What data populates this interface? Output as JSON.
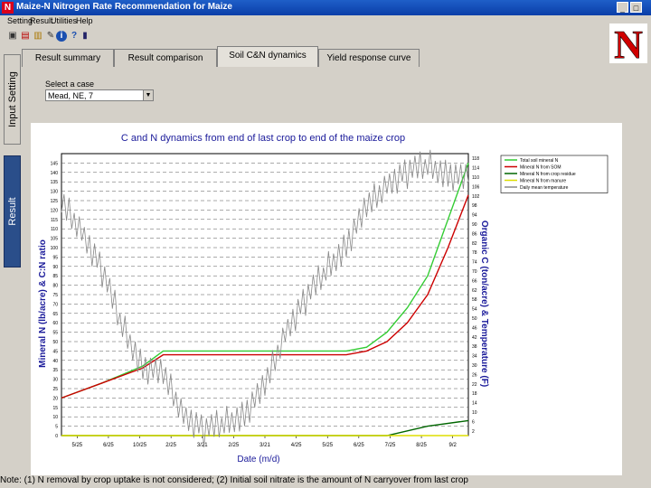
{
  "window": {
    "title": "Maize-N Nitrogen Rate Recommendation for Maize",
    "app_icon_letter": "N",
    "buttons": [
      "_",
      "□"
    ]
  },
  "menu": [
    "Setting",
    "Result",
    "Utilities",
    "Help"
  ],
  "toolbar": [
    {
      "icon": "save-icon",
      "glyph": "▣"
    },
    {
      "icon": "open-icon",
      "glyph": "▤"
    },
    {
      "icon": "print-icon",
      "glyph": "▥"
    },
    {
      "icon": "edit-icon",
      "glyph": "✎"
    },
    {
      "icon": "info-icon",
      "glyph": "i"
    },
    {
      "icon": "help-icon",
      "glyph": "?"
    },
    {
      "icon": "exit-icon",
      "glyph": "▮"
    }
  ],
  "logo": {
    "letter": "N",
    "color": "#d00000"
  },
  "side_tabs": {
    "input": "Input Setting",
    "result": "Result"
  },
  "tabs": [
    "Result summary",
    "Result comparison",
    "Soil C&N dynamics",
    "Yield response curve"
  ],
  "active_tab": 2,
  "case_select": {
    "label": "Select a case",
    "value": "Mead, NE, 7"
  },
  "footnote": "Note: (1) N removal by crop uptake is not considered; (2) Initial soil nitrate is the amount of N carryover from last crop",
  "chart_data": {
    "type": "line",
    "title": "C and N dynamics from end of last crop to end of the maize crop",
    "xlabel": "Date (m/d)",
    "ylabel": "Mineral N (lb/acre) & C:N ratio",
    "y2label": "Organic C (ton/acre) & Temperature (F)",
    "x_ticks": [
      "5/25",
      "6/25",
      "10/25",
      "2/25",
      "3/21",
      "2/25",
      "3/21",
      "4/25",
      "5/25",
      "6/25",
      "7/25",
      "8/25",
      "9/2"
    ],
    "y_ticks": [
      0,
      5,
      10,
      15,
      20,
      25,
      30,
      35,
      40,
      45,
      50,
      55,
      60,
      65,
      70,
      75,
      80,
      85,
      90,
      95,
      100,
      105,
      110,
      115,
      120,
      125,
      130,
      135,
      140,
      145
    ],
    "ylim": [
      0,
      150
    ],
    "y2_ticks": [
      2,
      6,
      10,
      14,
      18,
      22,
      26,
      30,
      34,
      38,
      42,
      46,
      50,
      54,
      58,
      62,
      66,
      70,
      74,
      78,
      82,
      86,
      90,
      94,
      98,
      102,
      106,
      110,
      114,
      118
    ],
    "y2lim": [
      0,
      120
    ],
    "x_range": [
      0,
      100
    ],
    "grid": "horizontal dashed",
    "legend_position": "top-right",
    "series": [
      {
        "name": "Total soil mineral N",
        "color": "#33cc33",
        "axis": "left",
        "x": [
          0,
          10,
          20,
          25,
          35,
          50,
          60,
          70,
          75,
          80,
          85,
          90,
          95,
          100
        ],
        "y": [
          20,
          28,
          37,
          45,
          45,
          45,
          45,
          45,
          47,
          55,
          68,
          85,
          115,
          145
        ]
      },
      {
        "name": "Mineral N from SOM",
        "color": "#cc0000",
        "axis": "left",
        "x": [
          0,
          10,
          20,
          25,
          35,
          50,
          60,
          70,
          75,
          80,
          85,
          90,
          95,
          100
        ],
        "y": [
          20,
          28,
          36,
          43,
          43,
          43,
          43,
          43,
          45,
          50,
          60,
          75,
          100,
          128
        ]
      },
      {
        "name": "Mineral N from crop residue",
        "color": "#006600",
        "axis": "left",
        "x": [
          0,
          20,
          40,
          60,
          65,
          70,
          80,
          90,
          100
        ],
        "y": [
          0,
          0,
          0,
          0,
          0,
          0,
          0,
          5,
          8
        ]
      },
      {
        "name": "Mineral N from manure",
        "color": "#dddd00",
        "axis": "left",
        "x": [
          0,
          100
        ],
        "y": [
          0,
          0
        ]
      },
      {
        "name": "Daily mean temperature",
        "color": "#888888",
        "axis": "right",
        "x": [
          0,
          5,
          10,
          15,
          20,
          25,
          30,
          35,
          40,
          45,
          50,
          55,
          60,
          65,
          70,
          75,
          80,
          85,
          90,
          95,
          100
        ],
        "y": [
          98,
          88,
          70,
          46,
          30,
          25,
          10,
          2,
          5,
          10,
          20,
          45,
          58,
          70,
          82,
          96,
          108,
          112,
          115,
          112,
          108
        ]
      }
    ]
  }
}
